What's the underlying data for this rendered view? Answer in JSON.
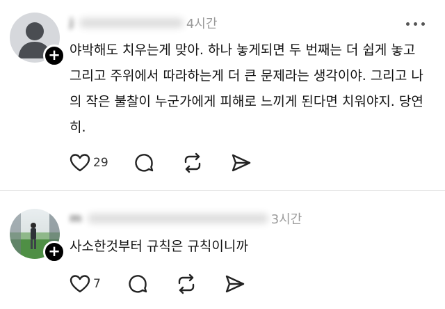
{
  "posts": [
    {
      "username": "j",
      "time": "4시간",
      "text": "야박해도 치우는게 맞아. 하나 놓게되면 두 번째는 더 쉽게 놓고 그리고 주위에서 따라하는게 더 큰 문제라는 생각이야. 그리고 나의 작은 불찰이 누군가에게 피해로 느끼게 된다면 치워야지. 당연히.",
      "like_count": "29",
      "avatar": "default-person-icon"
    },
    {
      "username": "m",
      "time": "3시간",
      "text": "사소한것부터 규칙은 규칙이니까",
      "like_count": "7",
      "avatar": "photo-person-golf"
    }
  ],
  "icons": {
    "like": "heart-icon",
    "reply": "comment-icon",
    "repost": "repost-icon",
    "share": "send-icon",
    "follow": "plus-icon",
    "more": "more-icon"
  },
  "colors": {
    "background": "#ffffff",
    "text": "#111111",
    "secondary_text": "#9a9a9a",
    "badge": "#000000"
  }
}
